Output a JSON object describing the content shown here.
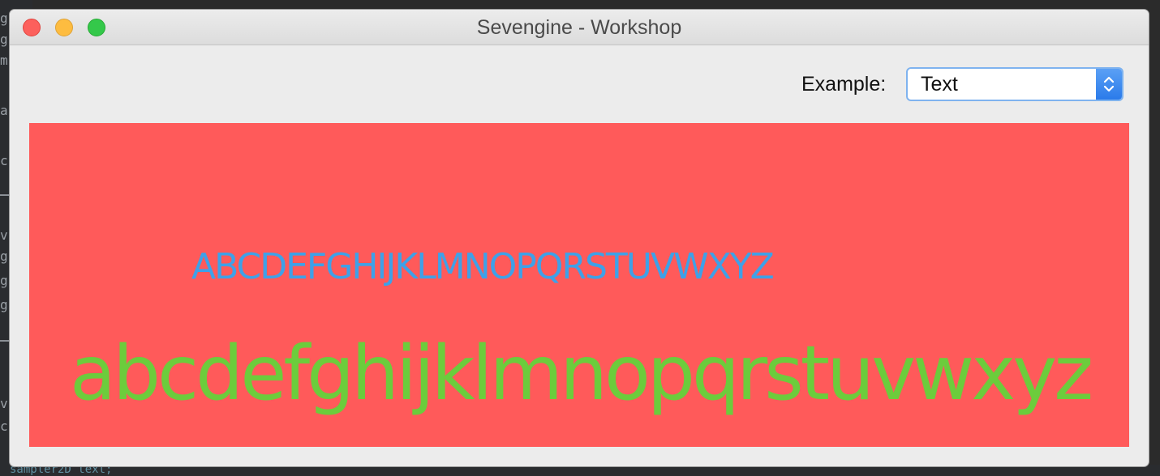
{
  "window": {
    "title": "Sevengine - Workshop"
  },
  "toolbar": {
    "example_label": "Example:",
    "example_value": "Text"
  },
  "canvas": {
    "background_color": "#ff5a5a",
    "uppercase_text": "ABCDEFGHIJKLMNOPQRSTUVWXYZ",
    "uppercase_color": "#3ea1e8",
    "lowercase_text": "abcdefghijklmnopqrstuvwxyz",
    "lowercase_color": "#6ccc3c"
  },
  "background_editor": {
    "left_fragments": [
      "g",
      "g",
      "m",
      "a",
      "c",
      "v",
      "g",
      "g",
      "g",
      "v",
      "c"
    ],
    "bottom_fragment": "sampler2D text;"
  }
}
